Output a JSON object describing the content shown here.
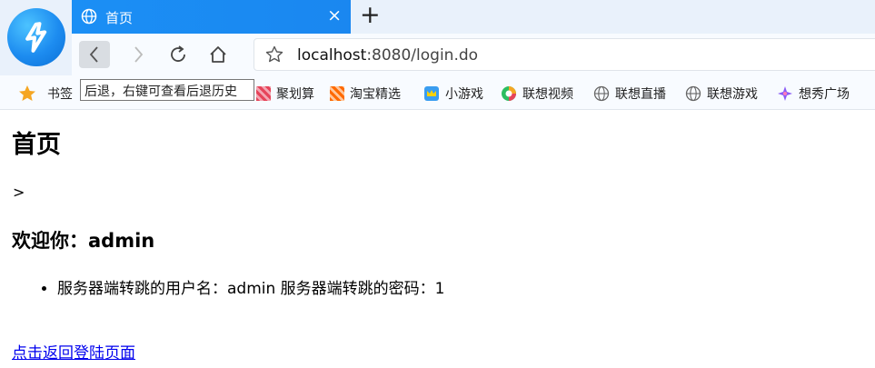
{
  "browser": {
    "tab": {
      "title": "首页",
      "close": "×"
    },
    "new_tab": "+",
    "address": {
      "host": "localhost",
      "rest": ":8080/login.do"
    },
    "tooltip": "后退，右键可查看后退历史",
    "bookmarks": [
      {
        "label": "书签",
        "icon": "star-icon",
        "color": "#f5a623"
      },
      {
        "label": "聚划算",
        "icon": "juhuasuan-icon",
        "color": "#e6445a"
      },
      {
        "label": "淘宝精选",
        "icon": "taobao-icon",
        "color": "#ff6a00"
      },
      {
        "label": "小游戏",
        "icon": "crown-icon",
        "color": "#f5b800"
      },
      {
        "label": "联想视频",
        "icon": "video-icon",
        "color": "#2dbe60"
      },
      {
        "label": "联想直播",
        "icon": "globe-icon",
        "color": "#666666"
      },
      {
        "label": "联想游戏",
        "icon": "globe-icon",
        "color": "#666666"
      },
      {
        "label": "想秀广场",
        "icon": "sparkle-icon",
        "color": "#8a5cf6"
      }
    ]
  },
  "page": {
    "title": "首页",
    "gt": ">",
    "welcome": "欢迎你：admin",
    "info": "服务器端转跳的用户名：admin 服务器端转跳的密码：1",
    "back_link": "点击返回登陆页面"
  }
}
